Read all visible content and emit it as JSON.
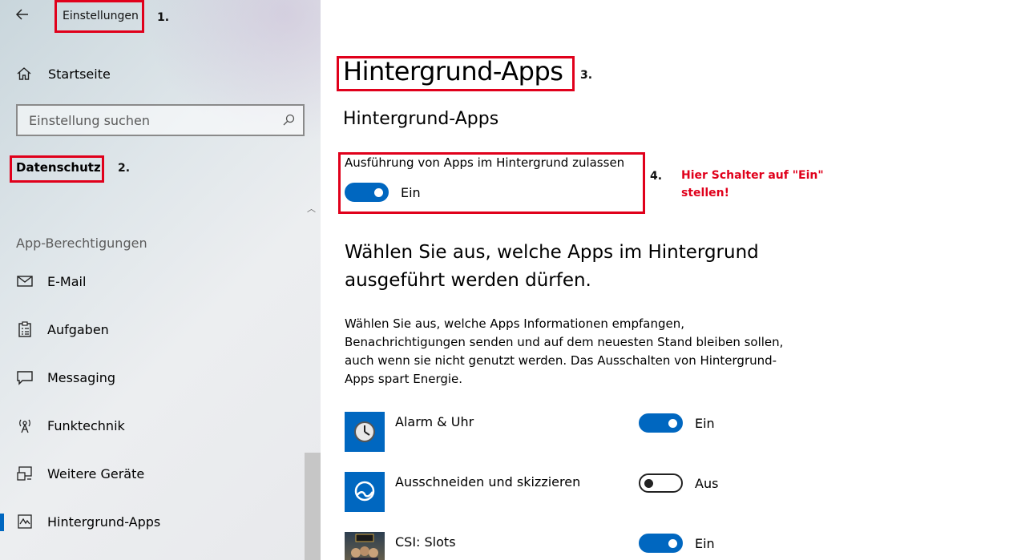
{
  "sidebar": {
    "app_title": "Einstellungen",
    "home_label": "Startseite",
    "search_placeholder": "Einstellung suchen",
    "category_heading": "Datenschutz",
    "section_label": "App-Berechtigungen",
    "items": [
      {
        "label": "E-Mail",
        "icon": "mail-icon"
      },
      {
        "label": "Aufgaben",
        "icon": "clipboard-icon"
      },
      {
        "label": "Messaging",
        "icon": "chat-icon"
      },
      {
        "label": "Funktechnik",
        "icon": "radio-tower-icon"
      },
      {
        "label": "Weitere Geräte",
        "icon": "devices-icon"
      },
      {
        "label": "Hintergrund-Apps",
        "icon": "background-apps-icon",
        "active": true
      }
    ]
  },
  "main": {
    "page_title": "Hintergrund-Apps",
    "sub_title": "Hintergrund-Apps",
    "master_toggle": {
      "label": "Ausführung von Apps im Hintergrund zulassen",
      "state": "Ein",
      "on": true
    },
    "choose_heading": "Wählen Sie aus, welche Apps im Hintergrund ausgeführt werden dürfen.",
    "description": "Wählen Sie aus, welche Apps Informationen empfangen, Benachrichtigungen senden und auf dem neuesten Stand bleiben sollen, auch wenn sie nicht genutzt werden. Das Ausschalten von Hintergrund-Apps spart Energie.",
    "apps": [
      {
        "name": "Alarm & Uhr",
        "state": "Ein",
        "on": true,
        "icon": "alarm-clock-icon"
      },
      {
        "name": "Ausschneiden und skizzieren",
        "state": "Aus",
        "on": false,
        "icon": "snip-sketch-icon"
      },
      {
        "name": "CSI: Slots",
        "state": "Ein",
        "on": true,
        "icon": "csi-slots-icon"
      }
    ]
  },
  "annotations": {
    "step1": "1.",
    "step2": "2.",
    "step3": "3.",
    "step4": "4.",
    "hint_line1": "Hier Schalter auf \"Ein\"",
    "hint_line2": "stellen!"
  },
  "colors": {
    "accent": "#0067c0",
    "annotation": "#e0001b"
  }
}
